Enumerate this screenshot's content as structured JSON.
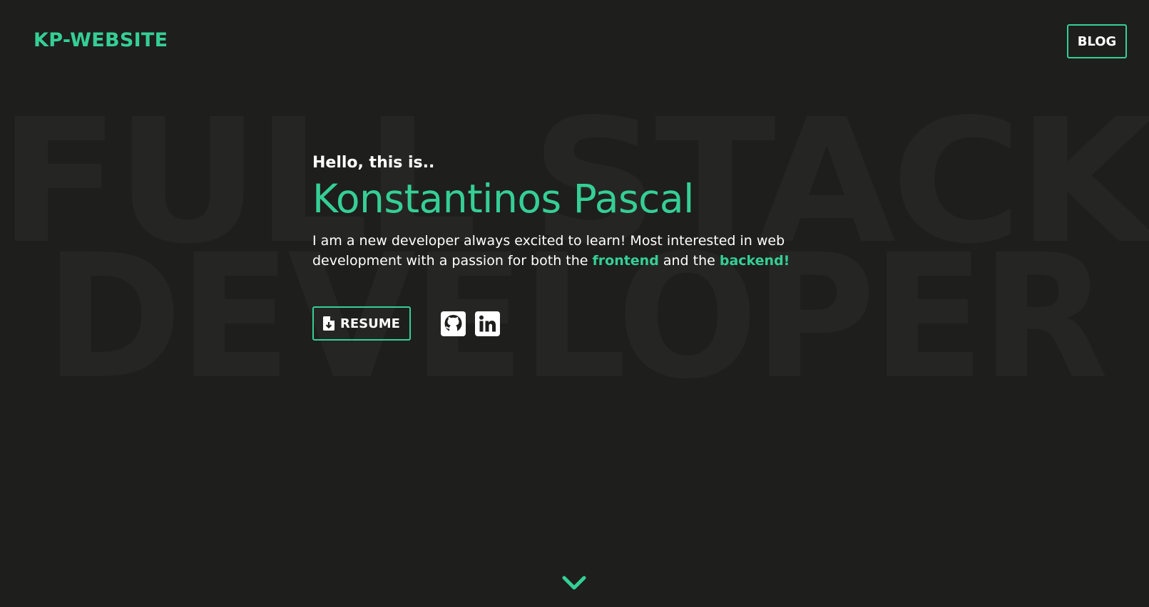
{
  "header": {
    "logo": "KP-WEBSITE",
    "blog_label": "BLOG"
  },
  "background": {
    "line1": "FULL STACK",
    "line2": "DEVELOPER"
  },
  "hero": {
    "greeting": "Hello, this is..",
    "name": "Konstantinos Pascal",
    "desc_part1": "I am a new developer always excited to learn! Most interested in web development with a passion for both the ",
    "desc_highlight1": "frontend",
    "desc_part2": " and the ",
    "desc_highlight2": "backend!"
  },
  "actions": {
    "resume_label": "RESUME",
    "icons": [
      "file-download-icon",
      "github-icon",
      "linkedin-icon"
    ]
  },
  "scroll": {
    "icon": "chevron-down-icon"
  },
  "colors": {
    "background": "#1e1e1d",
    "accent": "#35cf96",
    "text": "#ffffff",
    "background_text": "#252623"
  }
}
